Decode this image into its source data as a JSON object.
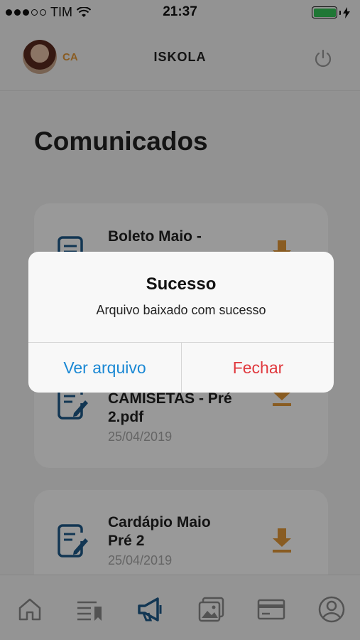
{
  "status_bar": {
    "carrier": "TIM",
    "time": "21:37",
    "signal_bars_filled": 3,
    "signal_bars_total": 5,
    "battery_level": 1.0,
    "battery_color": "#34c759"
  },
  "header": {
    "avatar_initials": "CA",
    "app_title": "ISKOLA",
    "power_icon": "power-icon"
  },
  "page": {
    "title": "Comunicados"
  },
  "cards": [
    {
      "title_line1": "Boleto Maio -",
      "title_line2": "",
      "date": "",
      "icon": "document-edit-icon",
      "action_icon": "download-icon"
    },
    {
      "title_line1": "CAMISETAS - Pré",
      "title_line2": "2.pdf",
      "date": "25/04/2019",
      "icon": "document-edit-icon",
      "action_icon": "download-icon"
    },
    {
      "title_line1": "Cardápio Maio",
      "title_line2": "Pré 2",
      "date": "25/04/2019",
      "icon": "document-edit-icon",
      "action_icon": "download-icon"
    }
  ],
  "tab_bar": {
    "items": [
      "home-icon",
      "list-bookmark-icon",
      "megaphone-icon",
      "photos-icon",
      "card-icon",
      "profile-icon"
    ],
    "active_index": 2,
    "active_color": "#1f5b8a",
    "inactive_color": "#8a8a8a"
  },
  "alert": {
    "title": "Sucesso",
    "message": "Arquivo baixado com sucesso",
    "primary_button": "Ver arquivo",
    "secondary_button": "Fechar"
  },
  "colors": {
    "accent_blue": "#1a88d4",
    "accent_orange": "#e59a3a",
    "destructive_red": "#e0393e"
  }
}
